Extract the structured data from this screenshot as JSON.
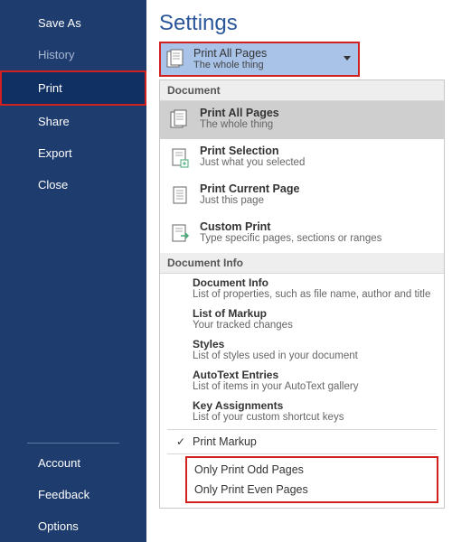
{
  "sidebar": {
    "items": [
      {
        "label": "Save As",
        "dim": false
      },
      {
        "label": "History",
        "dim": true
      },
      {
        "label": "Print",
        "dim": false,
        "selected": true
      },
      {
        "label": "Share",
        "dim": false
      },
      {
        "label": "Export",
        "dim": false
      },
      {
        "label": "Close",
        "dim": false
      }
    ],
    "bottom": [
      {
        "label": "Account"
      },
      {
        "label": "Feedback"
      },
      {
        "label": "Options"
      }
    ]
  },
  "header": "Settings",
  "selector": {
    "title": "Print All Pages",
    "sub": "The whole thing"
  },
  "groups": {
    "document": "Document",
    "document_info": "Document Info"
  },
  "doc_options": [
    {
      "title": "Print All Pages",
      "sub": "The whole thing",
      "selected": true,
      "icon": "pages"
    },
    {
      "title": "Print Selection",
      "sub": "Just what you selected",
      "icon": "page-plus"
    },
    {
      "title": "Print Current Page",
      "sub": "Just this page",
      "icon": "page-single"
    },
    {
      "title": "Custom Print",
      "sub": "Type specific pages, sections or ranges",
      "icon": "page-arrow"
    }
  ],
  "info_options": [
    {
      "title": "Document Info",
      "sub": "List of properties, such as file name, author and title"
    },
    {
      "title": "List of Markup",
      "sub": "Your tracked changes"
    },
    {
      "title": "Styles",
      "sub": "List of styles used in your document"
    },
    {
      "title": "AutoText Entries",
      "sub": "List of items in your AutoText gallery"
    },
    {
      "title": "Key Assignments",
      "sub": "List of your custom shortcut keys"
    }
  ],
  "print_markup": {
    "label": "Print Markup",
    "checked": true
  },
  "odd_even": {
    "odd": "Only Print Odd Pages",
    "even": "Only Print Even Pages"
  }
}
